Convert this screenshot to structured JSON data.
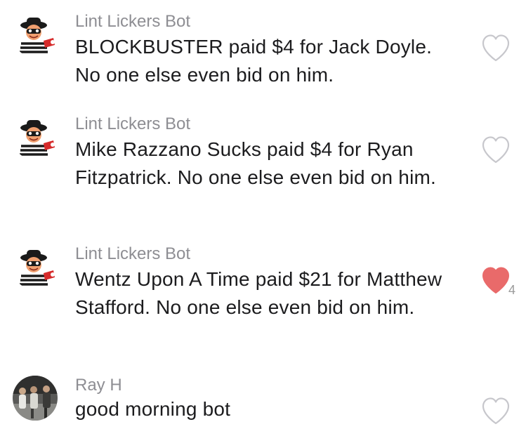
{
  "messages": [
    {
      "author": "Lint Lickers Bot",
      "avatar": "hamburglar-avatar",
      "text": "BLOCKBUSTER paid $4 for Jack Doyle. No one else even bid on him.",
      "liked": false,
      "like_count": ""
    },
    {
      "author": "Lint Lickers Bot",
      "avatar": "hamburglar-avatar",
      "text": "Mike Razzano Sucks paid $4 for Ryan Fitzpatrick. No one else even bid on him.",
      "liked": false,
      "like_count": ""
    },
    {
      "author": "Lint Lickers Bot",
      "avatar": "hamburglar-avatar",
      "text": "Wentz Upon A Time paid $21 for Matthew Stafford. No one else even bid on him.",
      "liked": true,
      "like_count": "4"
    },
    {
      "author": "Ray H",
      "avatar": "photo-avatar",
      "text": "good morning bot",
      "liked": false,
      "like_count": ""
    }
  ],
  "colors": {
    "author": "#8e8e93",
    "text": "#1c1c1e",
    "heart_outline": "#c7c7cc",
    "heart_liked": "#e96a6a",
    "like_count": "#9b9b9b"
  },
  "icons": {
    "like_empty": "heart-outline-icon",
    "like_filled": "heart-filled-icon"
  }
}
